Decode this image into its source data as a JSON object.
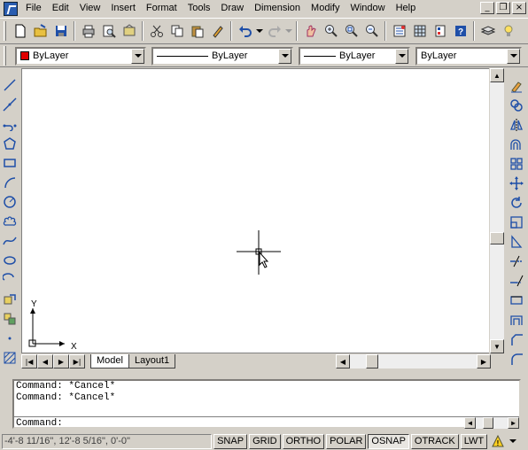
{
  "menu": {
    "items": [
      "File",
      "Edit",
      "View",
      "Insert",
      "Format",
      "Tools",
      "Draw",
      "Dimension",
      "Modify",
      "Window",
      "Help"
    ],
    "window_controls": [
      "_",
      "❐",
      "×"
    ]
  },
  "standard_toolbar": {
    "buttons": [
      "new-icon",
      "open-icon",
      "save-icon",
      "print-icon",
      "print-preview-icon",
      "publish-icon",
      "cut-icon",
      "copy-icon",
      "paste-icon",
      "match-properties-icon",
      "undo-icon",
      "redo-icon",
      "pan-icon",
      "zoom-realtime-icon",
      "zoom-window-icon",
      "zoom-previous-icon",
      "properties-icon",
      "design-center-icon",
      "tool-palettes-icon",
      "help-icon",
      "layers-icon",
      "lightbulb-icon"
    ]
  },
  "properties_toolbar": {
    "color": {
      "value": "ByLayer",
      "swatch": "#e00000"
    },
    "linetype": {
      "value": "ByLayer"
    },
    "lineweight": {
      "value": "ByLayer"
    },
    "plotstyle": {
      "value": "ByLayer"
    }
  },
  "draw_toolbar": [
    "line-icon",
    "construction-line-icon",
    "polyline-icon",
    "polygon-icon",
    "rectangle-icon",
    "arc-icon",
    "circle-icon",
    "revision-cloud-icon",
    "spline-icon",
    "ellipse-icon",
    "ellipse-arc-icon",
    "insert-block-icon",
    "make-block-icon",
    "point-icon",
    "hatch-icon"
  ],
  "modify_toolbar": [
    "erase-icon",
    "copy-object-icon",
    "mirror-icon",
    "offset-icon",
    "array-icon",
    "move-icon",
    "rotate-icon",
    "scale-icon",
    "stretch-icon",
    "trim-icon",
    "extend-icon",
    "break-icon",
    "join-icon",
    "chamfer-icon",
    "fillet-icon"
  ],
  "drawing": {
    "ucs": {
      "x_label": "X",
      "y_label": "Y"
    }
  },
  "tabs": {
    "items": [
      "Model",
      "Layout1"
    ],
    "active": "Model",
    "nav_buttons": [
      "|◀",
      "◀",
      "▶",
      "▶|"
    ]
  },
  "command_window": {
    "history": [
      "Command: *Cancel*",
      "Command: *Cancel*"
    ],
    "prompt": "Command:",
    "input_value": ""
  },
  "status": {
    "coordinates": "-4'-8 11/16\", 12'-8 5/16\", 0'-0\"",
    "toggles": [
      {
        "label": "SNAP",
        "on": false
      },
      {
        "label": "GRID",
        "on": false
      },
      {
        "label": "ORTHO",
        "on": false
      },
      {
        "label": "POLAR",
        "on": false
      },
      {
        "label": "OSNAP",
        "on": true
      },
      {
        "label": "OTRACK",
        "on": false
      },
      {
        "label": "LWT",
        "on": false
      }
    ]
  },
  "colors": {
    "chrome": "#d4d0c8",
    "canvas": "#ffffff",
    "icon_blue": "#1f4fa8"
  }
}
